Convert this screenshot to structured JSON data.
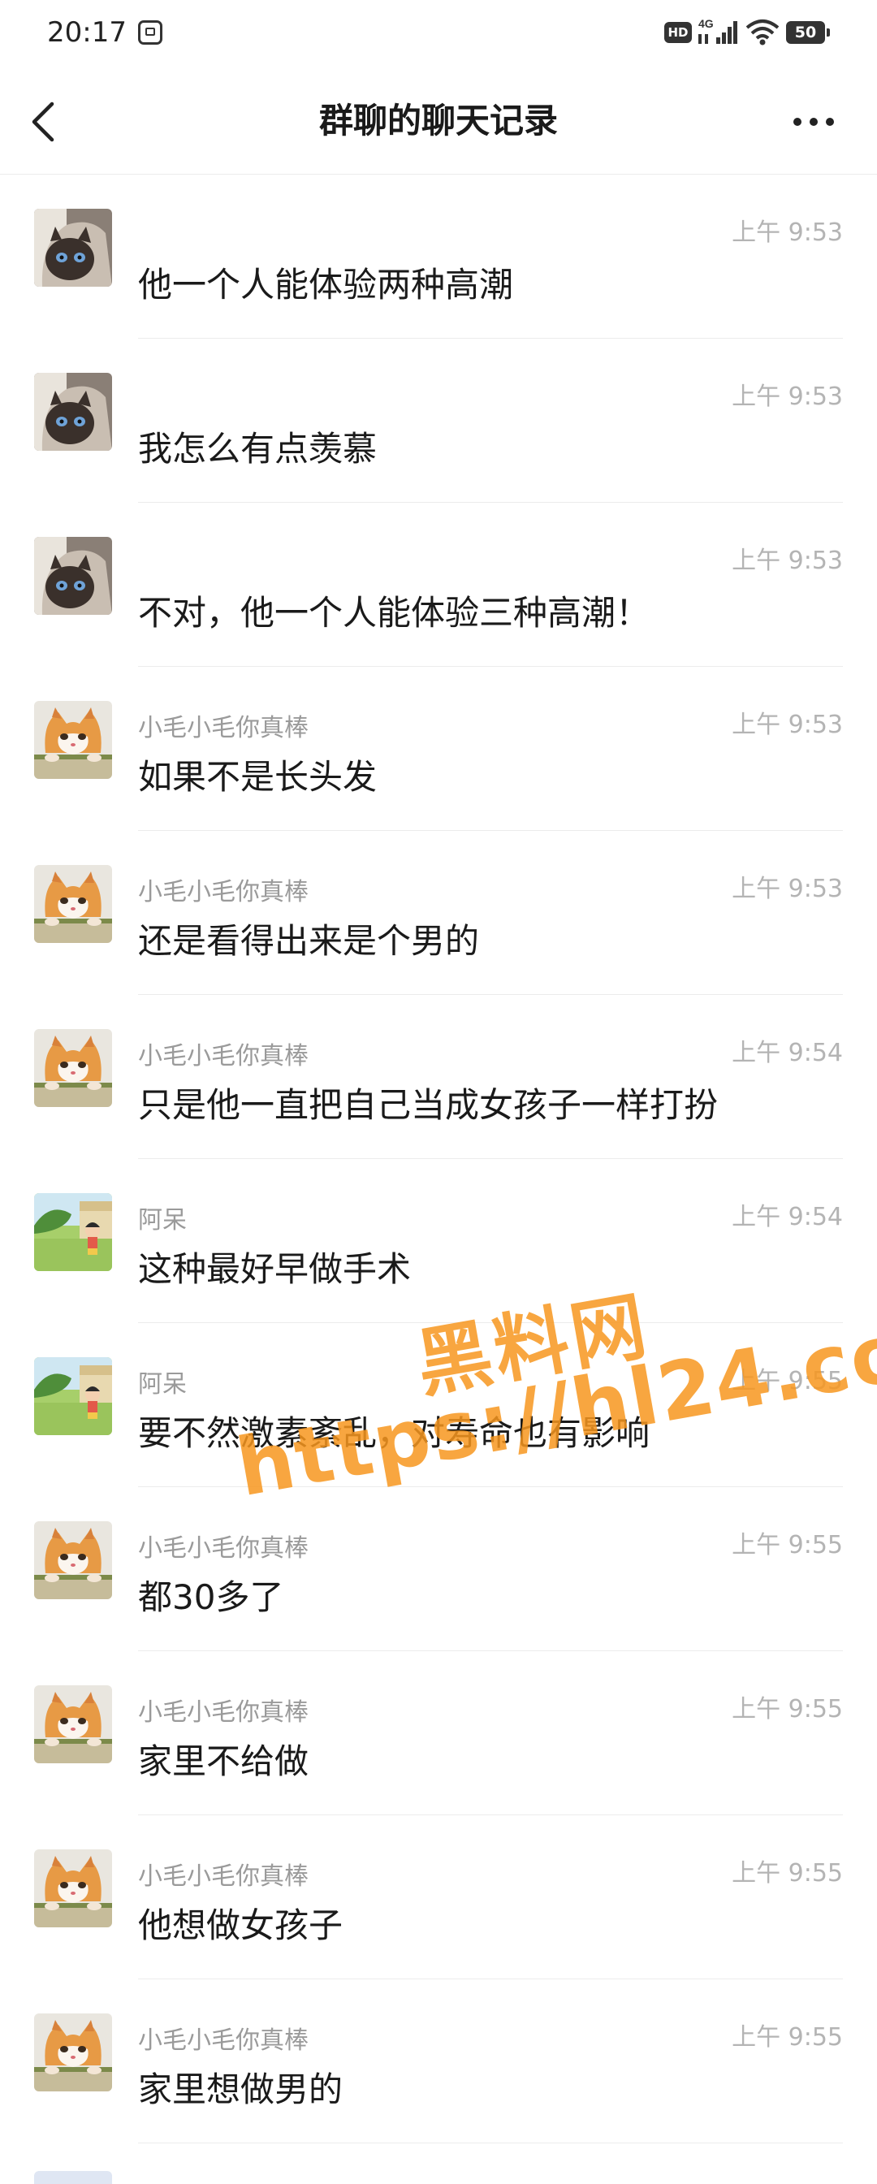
{
  "status_bar": {
    "time": "20:17",
    "hd_label": "HD",
    "network_label": "4G",
    "battery_level": "50"
  },
  "nav": {
    "title": "群聊的聊天记录"
  },
  "messages": [
    {
      "sender": "",
      "time": "上午 9:53",
      "text": "他一个人能体验两种高潮",
      "avatar": "siamese-cat-avatar"
    },
    {
      "sender": "",
      "time": "上午 9:53",
      "text": "我怎么有点羡慕",
      "avatar": "siamese-cat-avatar"
    },
    {
      "sender": "",
      "time": "上午 9:53",
      "text": "不对，他一个人能体验三种高潮！",
      "avatar": "siamese-cat-avatar"
    },
    {
      "sender": "小毛小毛你真棒",
      "time": "上午 9:53",
      "text": "如果不是长头发",
      "avatar": "orange-cat-avatar"
    },
    {
      "sender": "小毛小毛你真棒",
      "time": "上午 9:53",
      "text": "还是看得出来是个男的",
      "avatar": "orange-cat-avatar"
    },
    {
      "sender": "小毛小毛你真棒",
      "time": "上午 9:54",
      "text": "只是他一直把自己当成女孩子一样打扮",
      "avatar": "orange-cat-avatar"
    },
    {
      "sender": "阿呆",
      "time": "上午 9:54",
      "text": "这种最好早做手术",
      "avatar": "cartoon-avatar"
    },
    {
      "sender": "阿呆",
      "time": "上午 9:55",
      "text": "要不然激素紊乱，对寿命也有影响",
      "avatar": "cartoon-avatar"
    },
    {
      "sender": "小毛小毛你真棒",
      "time": "上午 9:55",
      "text": "都30多了",
      "avatar": "orange-cat-avatar"
    },
    {
      "sender": "小毛小毛你真棒",
      "time": "上午 9:55",
      "text": "家里不给做",
      "avatar": "orange-cat-avatar"
    },
    {
      "sender": "小毛小毛你真棒",
      "time": "上午 9:55",
      "text": "他想做女孩子",
      "avatar": "orange-cat-avatar"
    },
    {
      "sender": "小毛小毛你真棒",
      "time": "上午 9:55",
      "text": "家里想做男的",
      "avatar": "orange-cat-avatar"
    }
  ],
  "watermark": {
    "line1": "黑料网",
    "line2": "https://hl24.co",
    "color": "#f7961e"
  }
}
